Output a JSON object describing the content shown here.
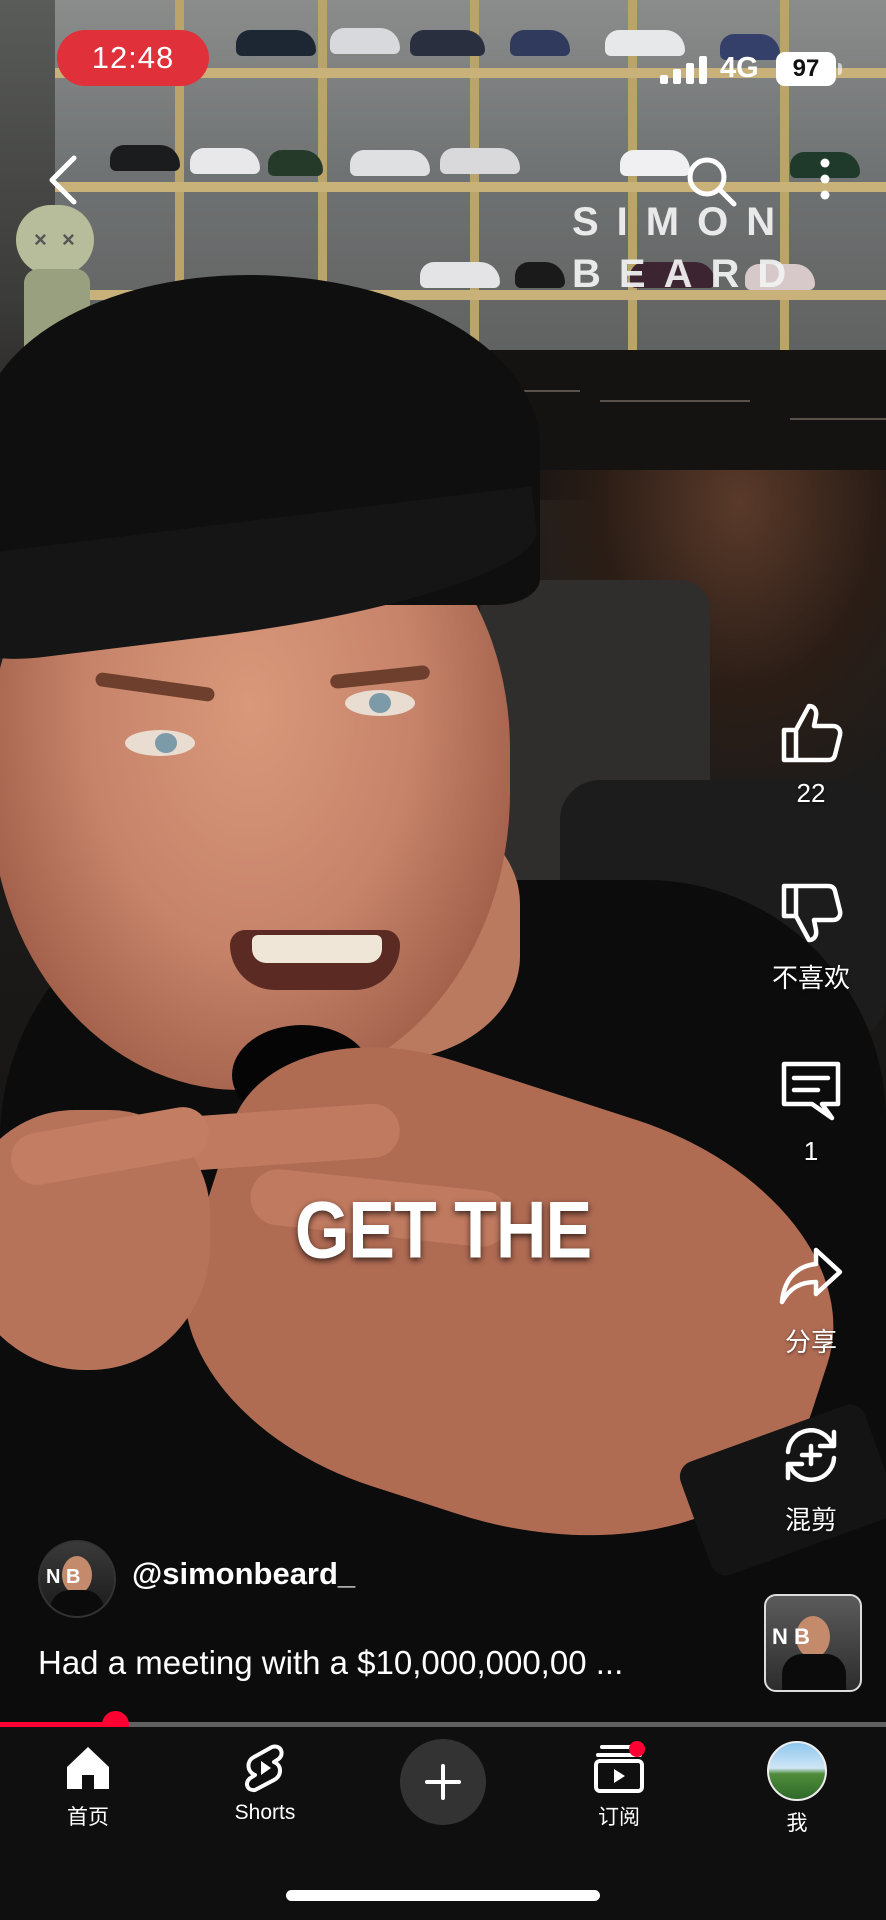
{
  "status_bar": {
    "time": "12:48",
    "network": "4G",
    "battery": "97"
  },
  "video": {
    "watermark_line1": "SIMON",
    "watermark_line2": "BEARD",
    "caption": "GET THE",
    "progress": 0.13
  },
  "actions": {
    "like_count": "22",
    "dislike_label": "不喜欢",
    "comment_count": "1",
    "share_label": "分享",
    "remix_label": "混剪"
  },
  "channel": {
    "handle": "@simonbeard_",
    "avatar_letters": "N B",
    "description": "Had a meeting with a $10,000,000,00 ..."
  },
  "bottom_nav": {
    "home": "首页",
    "shorts": "Shorts",
    "subscriptions": "订阅",
    "me": "我"
  },
  "colors": {
    "accent": "#ff0033",
    "time_pill": "#e0303a",
    "nav_bg": "#0f0f0f"
  }
}
